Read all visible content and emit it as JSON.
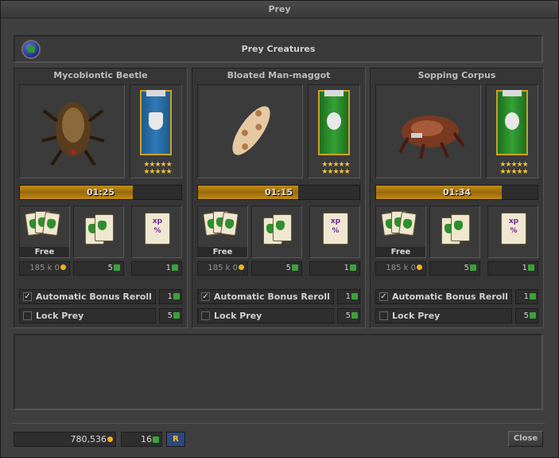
{
  "window": {
    "title": "Prey"
  },
  "header": {
    "title": "Prey Creatures",
    "icon": "globe-icon"
  },
  "slots": [
    {
      "name": "Mycobiontic Beetle",
      "banner_color": "#2f7ab8",
      "bonus_stars": "★★★★★ ★★★★★",
      "timer": "01:25",
      "timer_progress": 0.7,
      "free_label": "Free",
      "prices": {
        "list_reroll": "185 k 0",
        "bonus_reroll": "5",
        "select": "1"
      },
      "auto_bonus": {
        "label": "Automatic Bonus Reroll",
        "checked": true,
        "check_mark": "✓",
        "cost": "1"
      },
      "lock_prey": {
        "label": "Lock Prey",
        "checked": false,
        "cost": "5"
      }
    },
    {
      "name": "Bloated Man-maggot",
      "banner_color": "#34a234",
      "bonus_stars": "★★★★★ ★★★★★",
      "timer": "01:15",
      "timer_progress": 0.62,
      "free_label": "Free",
      "prices": {
        "list_reroll": "185 k 0",
        "bonus_reroll": "5",
        "select": "1"
      },
      "auto_bonus": {
        "label": "Automatic Bonus Reroll",
        "checked": true,
        "check_mark": "✓",
        "cost": "1"
      },
      "lock_prey": {
        "label": "Lock Prey",
        "checked": false,
        "cost": "5"
      }
    },
    {
      "name": "Sopping Corpus",
      "banner_color": "#34a234",
      "bonus_stars": "★★★★★ ★★★★★",
      "timer": "01:34",
      "timer_progress": 0.78,
      "free_label": "Free",
      "prices": {
        "list_reroll": "185 k 0",
        "bonus_reroll": "5",
        "select": "1"
      },
      "auto_bonus": {
        "label": "Automatic Bonus Reroll",
        "checked": true,
        "check_mark": "✓",
        "cost": "1"
      },
      "lock_prey": {
        "label": "Lock Prey",
        "checked": false,
        "cost": "5"
      }
    }
  ],
  "footer": {
    "gold": "780,536",
    "tokens": "16",
    "store_label": "R",
    "close_label": "Close"
  }
}
